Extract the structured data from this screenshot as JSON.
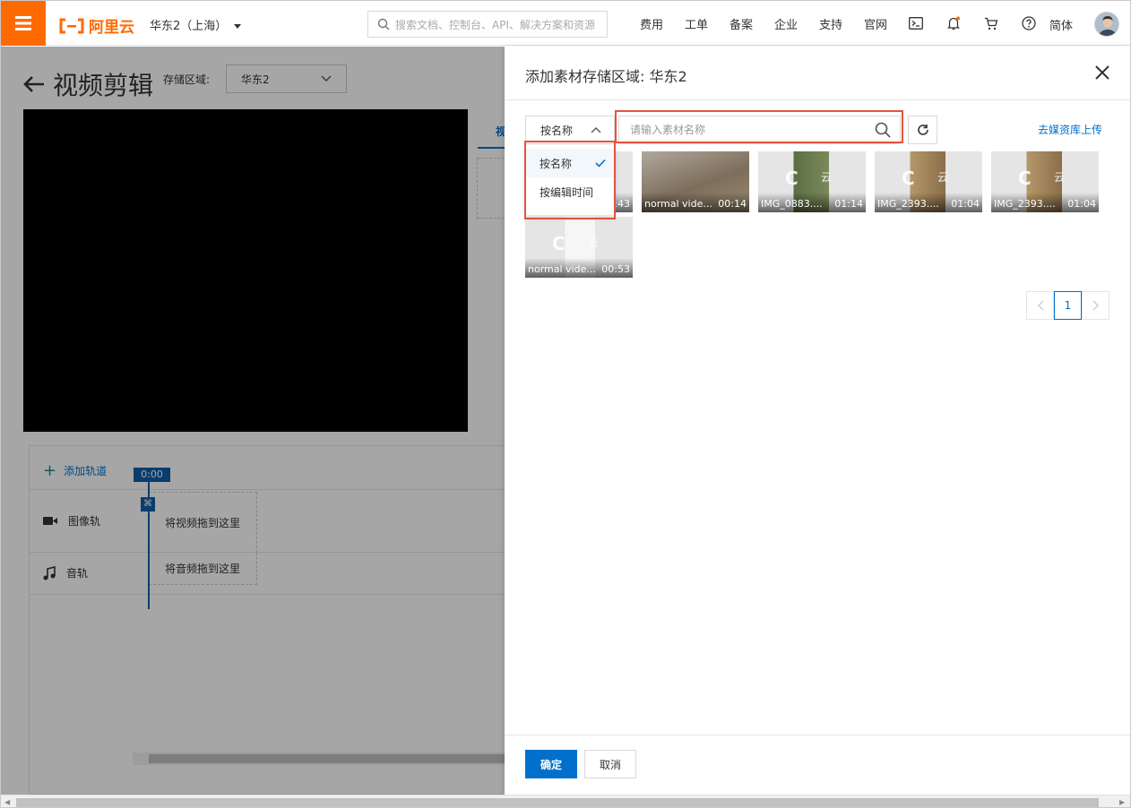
{
  "topbar": {
    "brand": "阿里云",
    "region": "华东2（上海）",
    "search_placeholder": "搜索文档、控制台、API、解决方案和资源",
    "nav": [
      "费用",
      "工单",
      "备案",
      "企业",
      "支持",
      "官网"
    ],
    "lang": "简体",
    "accent": "#ff6a00"
  },
  "page": {
    "title": "视频剪辑",
    "storage_label": "存储区域:",
    "storage_value": "华东2",
    "tab_fragment": "视"
  },
  "timeline": {
    "add_track": "添加轨道",
    "playhead_time": "0:00",
    "tracks": [
      {
        "label": "图像轨",
        "icon": "video-camera-icon",
        "drop_hint": "将视频拖到这里"
      },
      {
        "label": "音轨",
        "icon": "music-note-icon",
        "drop_hint": "将音频拖到这里"
      }
    ]
  },
  "panel": {
    "title": "添加素材存储区域:  华东2",
    "sort_value": "按名称",
    "sort_options": [
      "按名称",
      "按编辑时间"
    ],
    "search_placeholder": "请输入素材名称",
    "upload_link": "去媒资库上传",
    "materials": [
      {
        "name": "",
        "duration": ":43",
        "bg": "#a9a9a9"
      },
      {
        "name": "normal vide...",
        "duration": "00:14",
        "bg": "#8c8074"
      },
      {
        "name": "IMG_0883....",
        "duration": "01:14",
        "bg": "#6a7a52"
      },
      {
        "name": "IMG_2393....",
        "duration": "01:04",
        "bg": "#a98f6a"
      },
      {
        "name": "IMG_2393....",
        "duration": "01:04",
        "bg": "#a98f6a"
      },
      {
        "name": "normal vide...",
        "duration": "00:53",
        "bg": "#d8d8d8"
      }
    ],
    "page_current": "1",
    "ok_label": "确定",
    "cancel_label": "取消",
    "primary_color": "#0070cc",
    "highlight_color": "#e2533d"
  }
}
